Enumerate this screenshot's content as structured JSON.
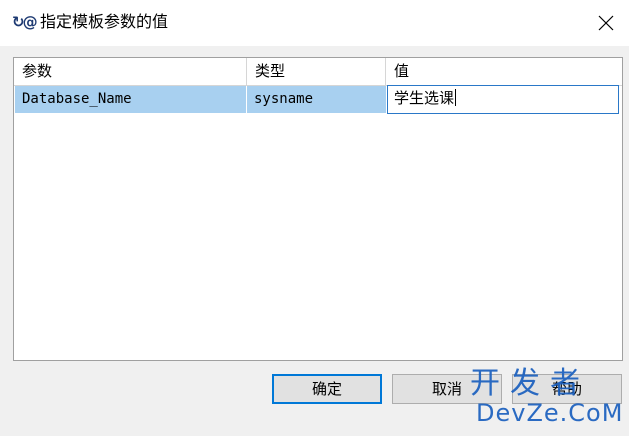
{
  "window": {
    "title": "指定模板参数的值",
    "icon": "template-param-icon",
    "icon_glyph": "↻@"
  },
  "grid": {
    "columns": [
      "参数",
      "类型",
      "值"
    ],
    "rows": [
      {
        "param": "Database_Name",
        "type": "sysname",
        "value": "学生选课"
      }
    ]
  },
  "buttons": {
    "ok": "确定",
    "cancel": "取消",
    "help": "帮助"
  },
  "watermark": {
    "cn": "开发者",
    "en": "DevZe.CoM"
  },
  "colors": {
    "selection": "#a8d0f0",
    "focus_border": "#0078d7",
    "watermark": "#1a5fbf"
  }
}
